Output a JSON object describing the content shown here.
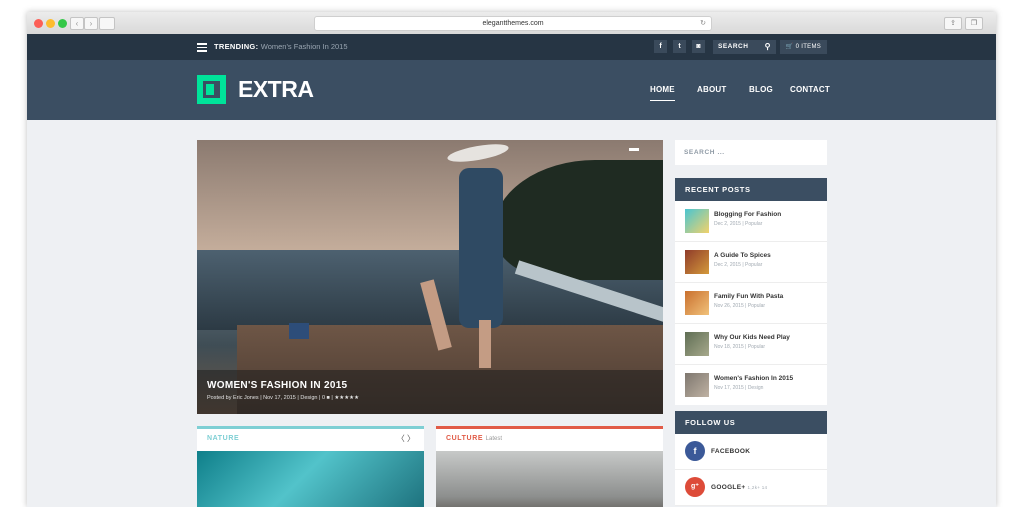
{
  "browser": {
    "url": "elegantthemes.com"
  },
  "topbar": {
    "trending_label": "TRENDING:",
    "trending_text": "Women's Fashion In 2015",
    "social": [
      "f",
      "t",
      "◙"
    ],
    "search_label": "SEARCH",
    "cart_label": "0 ITEMS"
  },
  "header": {
    "logo_text": "EXTRA",
    "nav": [
      "HOME",
      "ABOUT",
      "BLOG",
      "CONTACT"
    ]
  },
  "hero": {
    "title": "WOMEN'S FASHION IN 2015",
    "meta": "Posted by Eric Jones | Nov 17, 2015 | Design | 0 ■ | ★★★★★"
  },
  "sidebar": {
    "search_placeholder": "SEARCH ...",
    "recent_title": "RECENT POSTS",
    "recent_posts": [
      {
        "title": "Blogging For Fashion",
        "meta": "Dec 2, 2015 | Popular"
      },
      {
        "title": "A Guide To Spices",
        "meta": "Dec 2, 2015 | Popular"
      },
      {
        "title": "Family Fun With Pasta",
        "meta": "Nov 26, 2015 | Popular"
      },
      {
        "title": "Why Our Kids Need Play",
        "meta": "Nov 18, 2015 | Popular"
      },
      {
        "title": "Women's Fashion In 2015",
        "meta": "Nov 17, 2015 | Design"
      }
    ],
    "follow_title": "FOLLOW US",
    "follow": [
      {
        "label": "FACEBOOK",
        "icon": "f",
        "sub": ""
      },
      {
        "label": "GOOGLE+",
        "icon": "g⁺",
        "sub": "1,2k+ 14"
      }
    ]
  },
  "categories": [
    {
      "label": "NATURE",
      "sub": "",
      "color": "#7ecfd4"
    },
    {
      "label": "CULTURE",
      "sub": "Latest",
      "color": "#e15b47"
    }
  ],
  "colors": {
    "accent": "#00e39a",
    "header": "#3b4e62",
    "topbar": "#263544"
  }
}
